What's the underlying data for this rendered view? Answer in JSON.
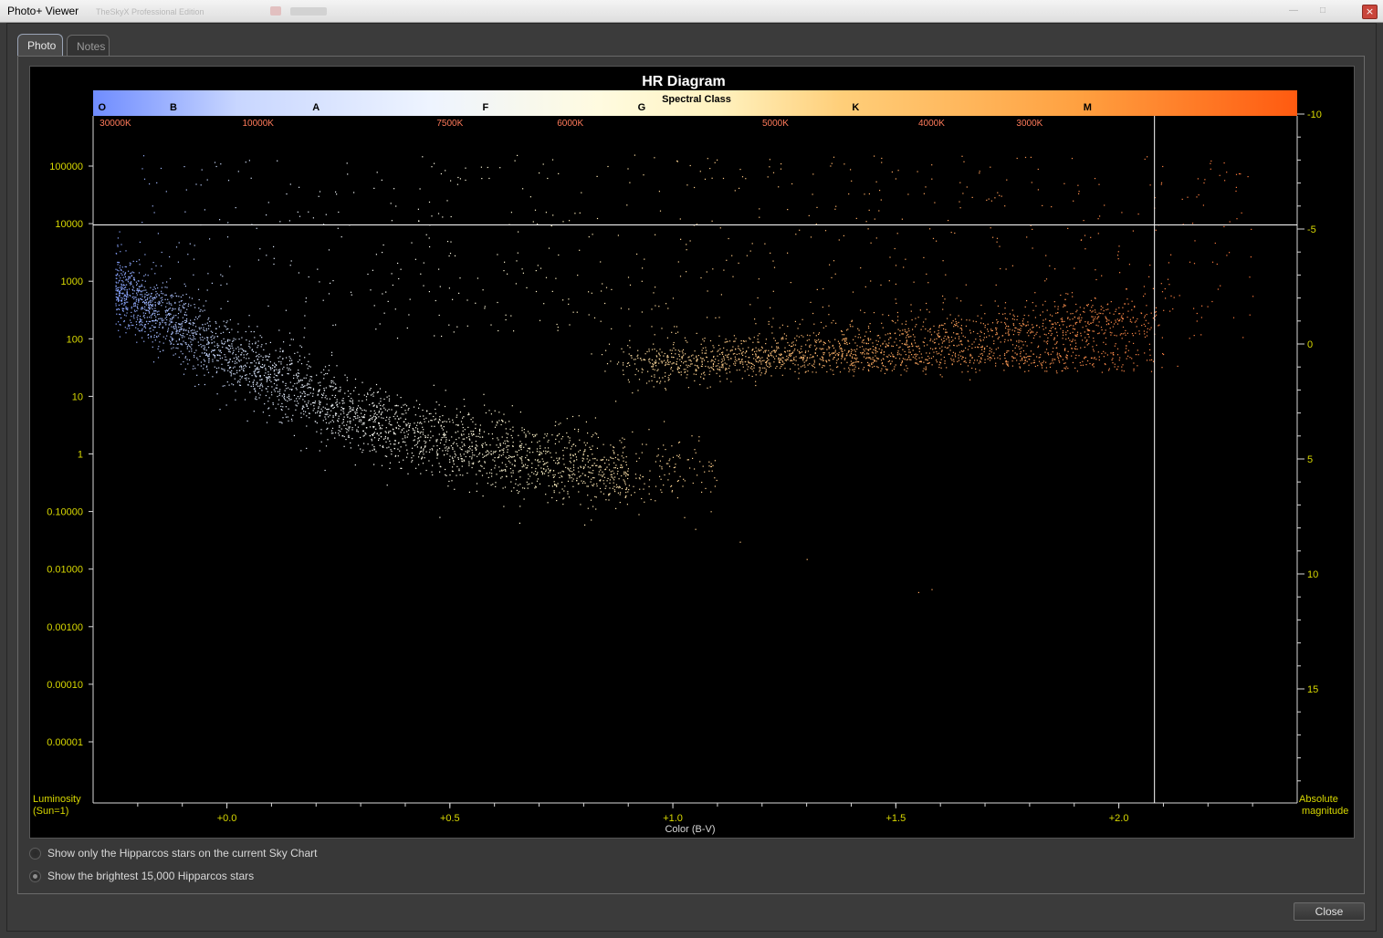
{
  "window": {
    "title": "Photo+ Viewer",
    "ghost_text": "TheSkyX Professional Edition",
    "close_glyph": "×"
  },
  "tabs": [
    {
      "label": "Photo",
      "active": true
    },
    {
      "label": "Notes",
      "active": false
    }
  ],
  "options": {
    "show_current_label": "Show only the Hipparcos stars on the current Sky Chart",
    "show_brightest_label": "Show the brightest 15,000 Hipparcos stars",
    "selected": "show_brightest"
  },
  "buttons": {
    "close_label": "Close"
  },
  "chart_data": {
    "type": "scatter",
    "title": "HR Diagram",
    "spectral_class_title": "Spectral Class",
    "xlabel": "Color (B-V)",
    "ylabel_left": "Luminosity\n(Sun=1)",
    "ylabel_right": "Absolute\nmagnitude",
    "xlim": [
      -0.3,
      2.4
    ],
    "y_left_scale": "log",
    "ylim_luminosity": [
      1e-06,
      1000000
    ],
    "ylim_magnitude": [
      -10,
      20
    ],
    "x_ticks": [
      "+0.0",
      "+0.5",
      "+1.0",
      "+1.5",
      "+2.0"
    ],
    "x_tick_values": [
      0.0,
      0.5,
      1.0,
      1.5,
      2.0
    ],
    "y_left_ticks": [
      "100000",
      "10000",
      "1000",
      "100",
      "10",
      "1",
      "0.10000",
      "0.01000",
      "0.00100",
      "0.00010",
      "0.00001"
    ],
    "y_left_tick_values": [
      100000,
      10000,
      1000,
      100,
      10,
      1,
      0.1,
      0.01,
      0.001,
      0.0001,
      1e-05
    ],
    "y_right_ticks": [
      "-10",
      "-5",
      "0",
      "5",
      "10",
      "15"
    ],
    "y_right_tick_values": [
      -10,
      -5,
      0,
      5,
      10,
      15
    ],
    "spectral_classes": [
      {
        "label": "O",
        "bv": -0.28
      },
      {
        "label": "B",
        "bv": -0.12
      },
      {
        "label": "A",
        "bv": 0.2
      },
      {
        "label": "F",
        "bv": 0.58
      },
      {
        "label": "G",
        "bv": 0.93
      },
      {
        "label": "K",
        "bv": 1.41
      },
      {
        "label": "M",
        "bv": 1.93
      }
    ],
    "temperatures": [
      {
        "label": "30000K",
        "bv": -0.25
      },
      {
        "label": "10000K",
        "bv": 0.07
      },
      {
        "label": "7500K",
        "bv": 0.5
      },
      {
        "label": "6000K",
        "bv": 0.77
      },
      {
        "label": "5000K",
        "bv": 1.23
      },
      {
        "label": "4000K",
        "bv": 1.58
      },
      {
        "label": "3000K",
        "bv": 1.8
      }
    ],
    "crosshair": {
      "bv": 2.08,
      "luminosity": 9500
    },
    "star_count": 15000,
    "colors": {
      "axis": "#d8d800",
      "title": "#ffffff",
      "temperature": "#ff7a5a",
      "grad_start": "#6f8cff",
      "grad_mid": "#fffbe0",
      "grad_end": "#ff5a10"
    }
  }
}
